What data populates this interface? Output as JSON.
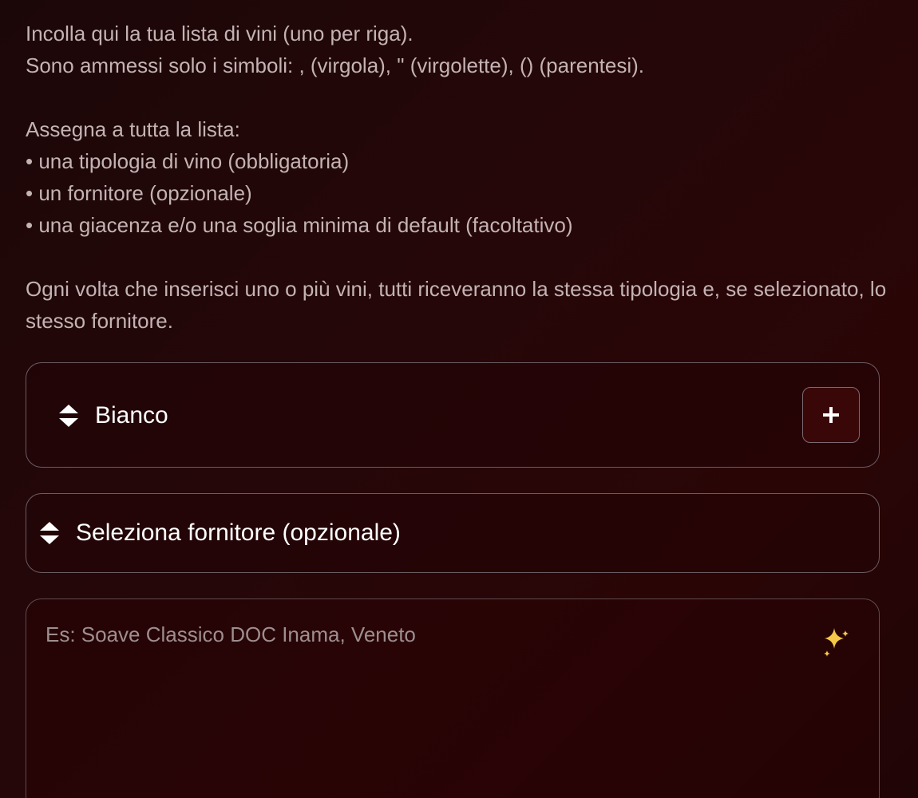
{
  "instructions": {
    "line1": "Incolla qui la tua lista di vini (uno per riga).",
    "line2": "Sono ammessi solo i simboli: , (virgola), \" (virgolette), () (parentesi).",
    "line3": "Assegna a tutta la lista:",
    "bullets": [
      "• una tipologia di vino (obbligatoria)",
      "• un fornitore (opzionale)",
      "• una giacenza e/o una soglia minima di default (facoltativo)"
    ],
    "line4": "Ogni volta che inserisci uno o più vini, tutti riceveranno la stessa tipologia e, se selezionato, lo stesso fornitore."
  },
  "tipologia_select": {
    "value": "Bianco",
    "icon": "sort-icon",
    "add_icon": "plus-icon"
  },
  "fornitore_select": {
    "value": "Seleziona fornitore (opzionale)",
    "icon": "sort-icon"
  },
  "wine_list_input": {
    "placeholder": "Es: Soave Classico DOC Inama, Veneto",
    "value": "",
    "icon": "sparkle-icon"
  },
  "colors": {
    "background": "#240709",
    "text": "#c4b3b3",
    "accent": "#3a0709",
    "sparkle": "#f5c84a"
  }
}
